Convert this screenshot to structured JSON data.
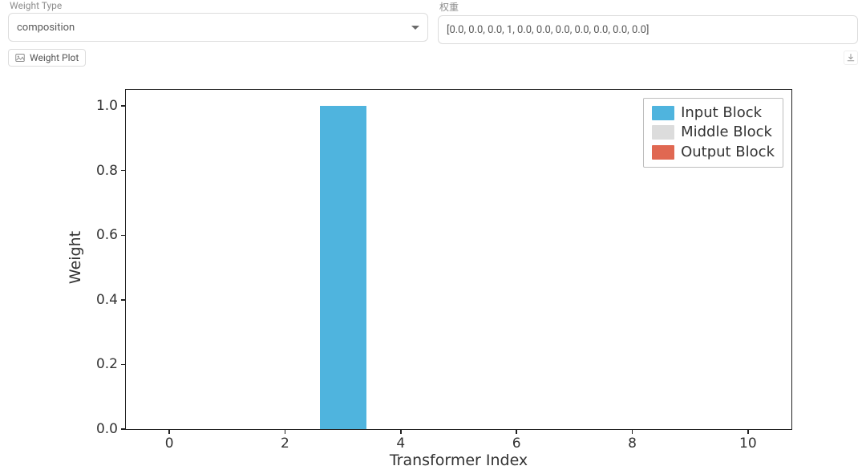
{
  "inputs": {
    "weight_type_label": "Weight Type",
    "weight_type_value": "composition",
    "weights_label": "权重",
    "weights_value": "[0.0, 0.0, 0.0, 1, 0.0, 0.0, 0.0, 0.0, 0.0, 0.0, 0.0]"
  },
  "chip": {
    "label": "Weight Plot"
  },
  "legend": {
    "input": {
      "label": "Input Block",
      "color": "#4fb4de"
    },
    "middle": {
      "label": "Middle Block",
      "color": "#dcdcdc"
    },
    "output": {
      "label": "Output Block",
      "color": "#e06852"
    }
  },
  "axis": {
    "xlabel": "Transformer Index",
    "ylabel": "Weight",
    "xticks": [
      "0",
      "2",
      "4",
      "6",
      "8",
      "10"
    ],
    "yticks": [
      "0.0",
      "0.2",
      "0.4",
      "0.6",
      "0.8",
      "1.0"
    ]
  },
  "chart_data": {
    "type": "bar",
    "title": "",
    "xlabel": "Transformer Index",
    "ylabel": "Weight",
    "xlim": [
      -0.75,
      10.75
    ],
    "ylim": [
      0.0,
      1.05
    ],
    "categories": [
      0,
      1,
      2,
      3,
      4,
      5,
      6,
      7,
      8,
      9,
      10
    ],
    "series": [
      {
        "name": "Input Block",
        "color": "#4fb4de",
        "values": [
          0.0,
          0.0,
          0.0,
          1.0,
          0.0,
          0.0,
          0.0,
          0.0,
          0.0,
          0.0,
          0.0
        ]
      },
      {
        "name": "Middle Block",
        "color": "#dcdcdc",
        "values": [
          0.0,
          0.0,
          0.0,
          0.0,
          0.0,
          0.0,
          0.0,
          0.0,
          0.0,
          0.0,
          0.0
        ]
      },
      {
        "name": "Output Block",
        "color": "#e06852",
        "values": [
          0.0,
          0.0,
          0.0,
          0.0,
          0.0,
          0.0,
          0.0,
          0.0,
          0.0,
          0.0,
          0.0
        ]
      }
    ],
    "legend_position": "upper right",
    "grid": false
  }
}
